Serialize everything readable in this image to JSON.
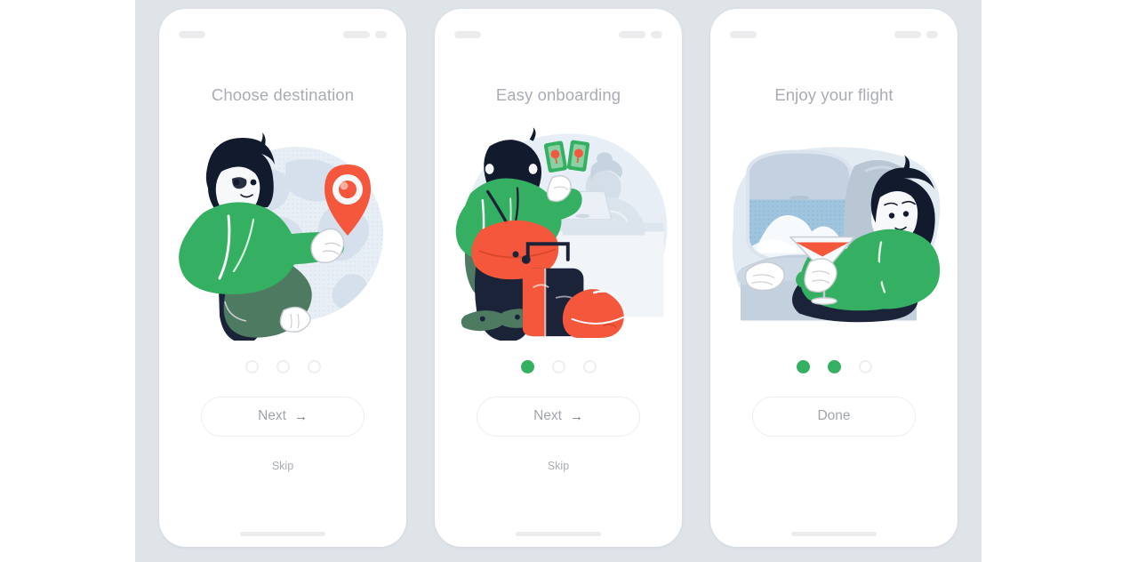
{
  "app": {
    "background_color": "#ffffff",
    "canvas_color": "#dfe4e9",
    "accent_color": "#35b062",
    "accent_secondary": "#f4573b",
    "text_muted": "#a9acb4"
  },
  "screens": [
    {
      "title": "Choose destination",
      "illustration": "woman-holding-map-pin-globe",
      "dots": [
        false,
        false,
        false
      ],
      "cta_label": "Next",
      "cta_arrow": "→",
      "skip_label": "Skip",
      "has_skip": true
    },
    {
      "title": "Easy onboarding",
      "illustration": "traveler-at-checkin-counter-with-luggage",
      "dots": [
        true,
        false,
        false
      ],
      "cta_label": "Next",
      "cta_arrow": "→",
      "skip_label": "Skip",
      "has_skip": true
    },
    {
      "title": "Enjoy your flight",
      "illustration": "woman-in-airplane-seat-with-drink",
      "dots": [
        true,
        true,
        false
      ],
      "cta_label": "Done",
      "cta_arrow": "",
      "skip_label": "",
      "has_skip": false
    }
  ]
}
